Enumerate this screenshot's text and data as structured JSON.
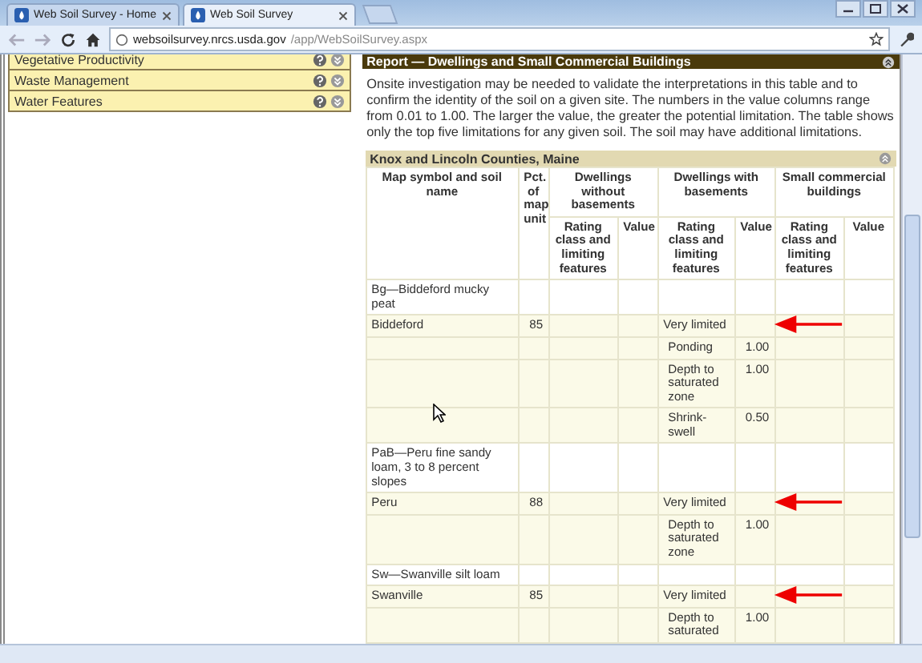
{
  "browser": {
    "tabs": [
      {
        "title": "Web Soil Survey - Home",
        "selected": false
      },
      {
        "title": "Web Soil Survey",
        "selected": true
      }
    ],
    "url_host": "websoilsurvey.nrcs.usda.gov",
    "url_path": "/app/WebSoilSurvey.aspx"
  },
  "sidebar": {
    "items": [
      {
        "label": "Vegetative Productivity"
      },
      {
        "label": "Waste Management"
      },
      {
        "label": "Water Features"
      }
    ]
  },
  "report": {
    "title": "Report — Dwellings and Small Commercial Buildings",
    "intro": "Onsite investigation may be needed to validate the interpretations in this table and to confirm the identity of the soil on a given site. The numbers in the value columns range from 0.01 to 1.00. The larger the value, the greater the potential limitation. The table shows only the top five limitations for any given soil. The soil may have additional limitations.",
    "area": "Knox and Lincoln Counties, Maine",
    "columns": {
      "name": "Map symbol and soil name",
      "pct": "Pct. of map unit",
      "groups": [
        "Dwellings without basements",
        "Dwellings with basements",
        "Small commercial buildings"
      ],
      "sub": [
        [
          "Rating class and limiting features",
          "Value"
        ],
        [
          "Rating class and limiting features",
          "Value"
        ],
        [
          "Rating class and limiting features",
          "Value"
        ]
      ]
    },
    "rows": [
      {
        "kind": "mapunit",
        "name": "Bg—Biddeford mucky peat"
      },
      {
        "kind": "component",
        "name": "Biddeford",
        "pct": "85",
        "dwb_rating": "Very limited",
        "arrow": true
      },
      {
        "kind": "feature",
        "dwb_rating": "Ponding",
        "dwb_value": "1.00"
      },
      {
        "kind": "feature",
        "dwb_rating": "Depth to saturated zone",
        "dwb_value": "1.00"
      },
      {
        "kind": "feature",
        "dwb_rating": "Shrink-swell",
        "dwb_value": "0.50"
      },
      {
        "kind": "mapunit",
        "name": "PaB—Peru fine sandy loam, 3 to 8 percent slopes"
      },
      {
        "kind": "component",
        "name": "Peru",
        "pct": "88",
        "dwb_rating": "Very limited",
        "arrow": true
      },
      {
        "kind": "feature",
        "dwb_rating": "Depth to saturated zone",
        "dwb_value": "1.00"
      },
      {
        "kind": "mapunit",
        "name": "Sw—Swanville silt loam"
      },
      {
        "kind": "component",
        "name": "Swanville",
        "pct": "85",
        "dwb_rating": "Very limited",
        "arrow": true
      },
      {
        "kind": "feature",
        "dwb_rating": "Depth to saturated",
        "dwb_value": "1.00"
      }
    ]
  }
}
